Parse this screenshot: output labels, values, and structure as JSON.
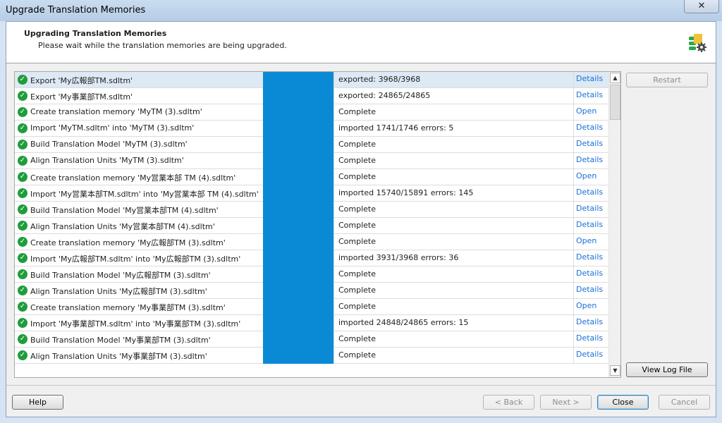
{
  "window": {
    "title": "Upgrade Translation Memories",
    "close_glyph": "✕"
  },
  "header": {
    "title": "Upgrading Translation Memories",
    "subtitle": "Please wait while the translation memories are being upgraded."
  },
  "tasks": [
    {
      "name": "Export 'My広報部TM.sdltm'",
      "status": "exported: 3968/3968",
      "link": "Details",
      "progress": 1.0,
      "selected": true
    },
    {
      "name": "Export 'My事業部TM.sdltm'",
      "status": "exported: 24865/24865",
      "link": "Details",
      "progress": 1.0
    },
    {
      "name": "Create translation memory 'MyTM (3).sdltm'",
      "status": "Complete",
      "link": "Open",
      "progress": 1.0
    },
    {
      "name": "Import 'MyTM.sdltm' into 'MyTM (3).sdltm'",
      "status": "imported 1741/1746 errors: 5",
      "link": "Details",
      "progress": 1.0
    },
    {
      "name": "Build Translation Model 'MyTM (3).sdltm'",
      "status": "Complete",
      "link": "Details",
      "progress": 1.0
    },
    {
      "name": "Align Translation Units 'MyTM (3).sdltm'",
      "status": "Complete",
      "link": "Details",
      "progress": 1.0
    },
    {
      "name": "Create translation memory 'My営業本部 TM (4).sdltm'",
      "status": "Complete",
      "link": "Open",
      "progress": 1.0
    },
    {
      "name": "Import 'My営業本部TM.sdltm' into 'My営業本部 TM (4).sdltm'",
      "status": "imported 15740/15891 errors: 145",
      "link": "Details",
      "progress": 1.0
    },
    {
      "name": "Build Translation Model 'My営業本部TM (4).sdltm'",
      "status": "Complete",
      "link": "Details",
      "progress": 1.0
    },
    {
      "name": "Align Translation Units 'My営業本部TM (4).sdltm'",
      "status": "Complete",
      "link": "Details",
      "progress": 1.0
    },
    {
      "name": "Create translation memory 'My広報部TM (3).sdltm'",
      "status": "Complete",
      "link": "Open",
      "progress": 1.0
    },
    {
      "name": "Import 'My広報部TM.sdltm' into 'My広報部TM (3).sdltm'",
      "status": "imported 3931/3968 errors: 36",
      "link": "Details",
      "progress": 1.0
    },
    {
      "name": "Build Translation Model 'My広報部TM (3).sdltm'",
      "status": "Complete",
      "link": "Details",
      "progress": 1.0
    },
    {
      "name": "Align Translation Units 'My広報部TM (3).sdltm'",
      "status": "Complete",
      "link": "Details",
      "progress": 1.0
    },
    {
      "name": "Create translation memory 'My事業部TM (3).sdltm'",
      "status": "Complete",
      "link": "Open",
      "progress": 1.0
    },
    {
      "name": "Import 'My事業部TM.sdltm' into 'My事業部TM (3).sdltm'",
      "status": "imported 24848/24865 errors: 15",
      "link": "Details",
      "progress": 1.0
    },
    {
      "name": "Build Translation Model 'My事業部TM (3).sdltm'",
      "status": "Complete",
      "link": "Details",
      "progress": 1.0
    },
    {
      "name": "Align Translation Units 'My事業部TM (3).sdltm'",
      "status": "Complete",
      "link": "Details",
      "progress": 1.0
    }
  ],
  "side_buttons": {
    "restart": "Restart",
    "view_log": "View Log File"
  },
  "footer": {
    "help": "Help",
    "back": "< Back",
    "next": "Next >",
    "close": "Close",
    "cancel": "Cancel"
  },
  "icons": {
    "check": "check-circle-icon",
    "header": "database-gear-icon"
  },
  "colors": {
    "progress": "#0a8ad4",
    "link": "#1a6fd6",
    "ok": "#1f9d3c"
  }
}
